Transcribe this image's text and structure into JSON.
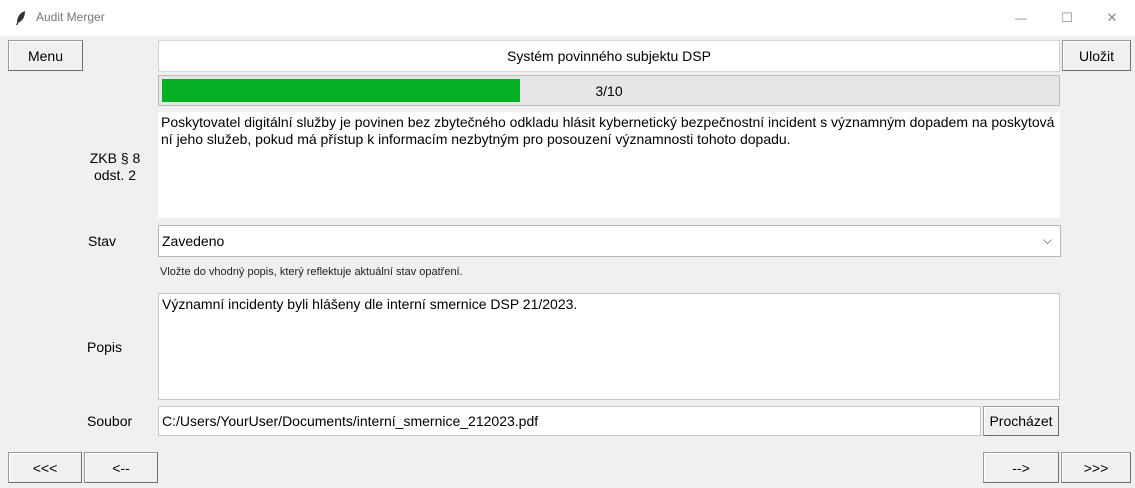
{
  "window": {
    "title": "Audit Merger",
    "minimize_glyph": "—",
    "maximize_glyph": "☐",
    "close_glyph": "✕"
  },
  "toolbar": {
    "menu_label": "Menu",
    "save_label": "Uložit",
    "header_text": "Systém povinného subjektu DSP"
  },
  "progress": {
    "text": "3/10",
    "value": 0.4,
    "color": "#06b025"
  },
  "requirement": {
    "reference": "ZKB § 8\nodst. 2",
    "text": "Poskytovatel digitální služby je povinen bez zbytečného odkladu hlásit kybernetický bezpečnostní incident s významným dopadem na poskytování jeho služeb, pokud má přístup k informacím nezbytným pro posouzení významnosti tohoto dopadu."
  },
  "status": {
    "label": "Stav",
    "selected": "Zavedeno",
    "hint": "Vložte do vhodný popis, který reflektuje aktuální stav opatření."
  },
  "description": {
    "label": "Popis",
    "value": "Významní incidenty byli hlášeny dle interní smernice DSP 21/2023."
  },
  "file": {
    "label": "Soubor",
    "path": "C:/Users/YourUser/Documents/interní_smernice_212023.pdf",
    "browse_label": "Procházet"
  },
  "navigation": {
    "first_label": "<<<",
    "prev_label": "<--",
    "next_label": "-->",
    "last_label": ">>>"
  }
}
